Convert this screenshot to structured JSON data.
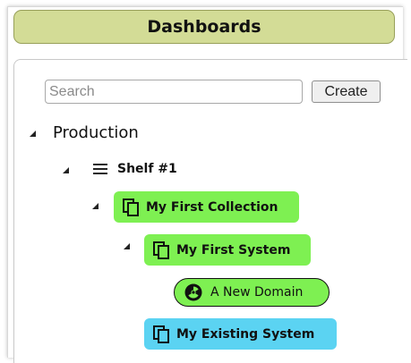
{
  "header": {
    "title": "Dashboards"
  },
  "search": {
    "placeholder": "Search"
  },
  "create_label": "Create",
  "tree": {
    "production": "Production",
    "shelf": "Shelf #1",
    "collection": "My First Collection",
    "system": "My First System",
    "domain": "A New Domain",
    "existing_system": "My Existing System"
  },
  "colors": {
    "header_bg": "#d3dc96",
    "green_node": "#7ef052",
    "blue_node": "#5bd3f2"
  },
  "icons": {
    "system": "copy-icon",
    "domain": "radiation-icon",
    "shelf": "hamburger-icon",
    "expand": "expanded-triangle-icon"
  }
}
